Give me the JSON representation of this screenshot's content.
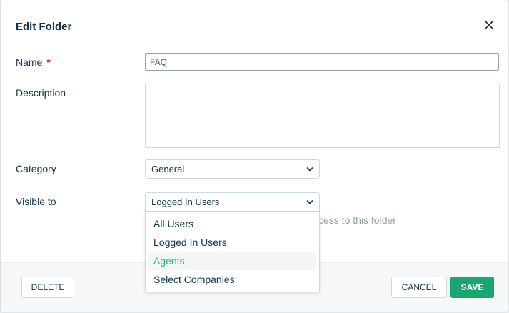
{
  "modal": {
    "title": "Edit Folder",
    "close_icon": "close-icon"
  },
  "form": {
    "name": {
      "label": "Name",
      "required_marker": "*",
      "value": "FAQ"
    },
    "description": {
      "label": "Description",
      "value": ""
    },
    "category": {
      "label": "Category",
      "selected": "General",
      "icon": "chevron-down-icon"
    },
    "visible_to": {
      "label": "Visible to",
      "selected": "Logged In Users",
      "icon": "chevron-down-icon",
      "hint_visible_fragment": "ccess to this folder",
      "options": [
        "All Users",
        "Logged In Users",
        "Agents",
        "Select Companies"
      ],
      "highlighted_option": "Agents"
    }
  },
  "footer": {
    "delete_label": "DELETE",
    "cancel_label": "CANCEL",
    "save_label": "SAVE"
  },
  "colors": {
    "primary": "#1ba570",
    "highlight_text": "#2cb480",
    "required": "#d72d30",
    "text": "#12344d"
  }
}
